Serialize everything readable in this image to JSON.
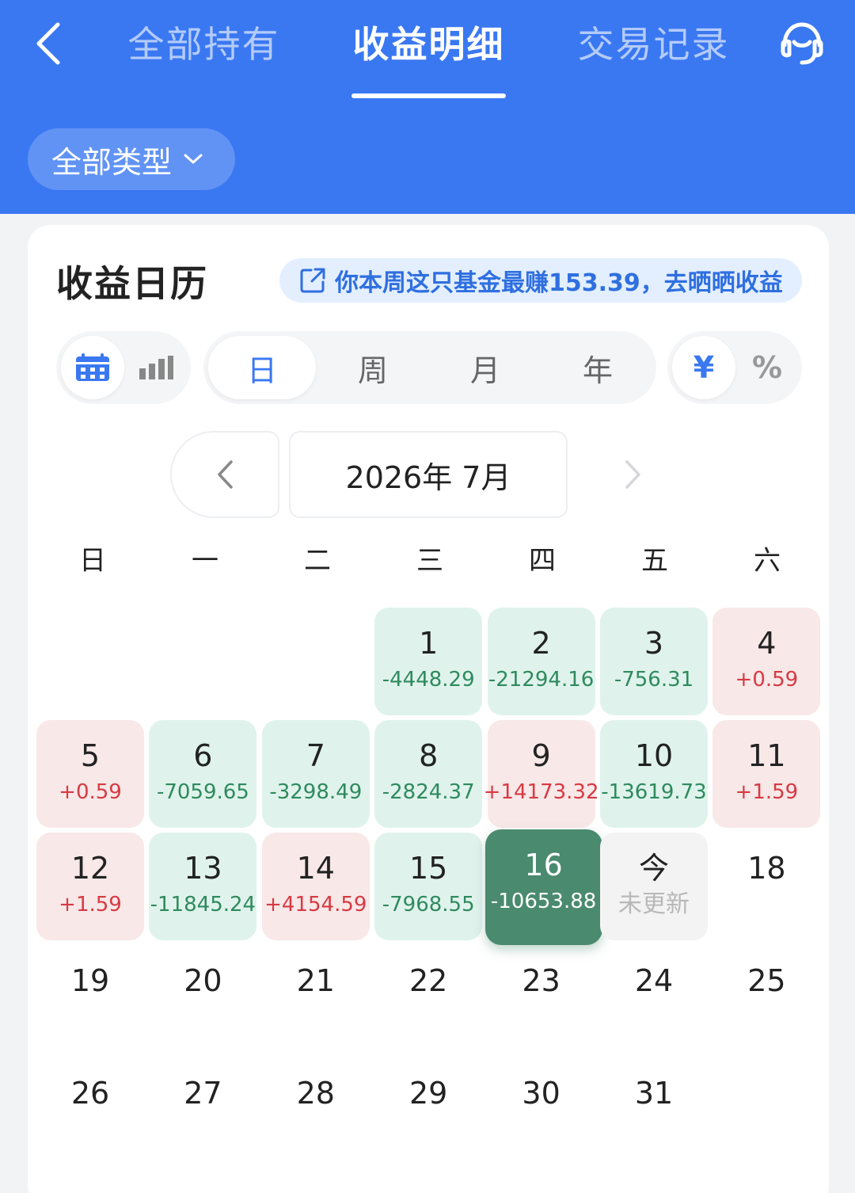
{
  "header": {
    "tabs": [
      {
        "label": "全部持有"
      },
      {
        "label": "收益明细"
      },
      {
        "label": "交易记录"
      }
    ],
    "type_filter": "全部类型"
  },
  "card": {
    "title": "收益日历",
    "promo": "你本周这只基金最赚153.39，去晒晒收益",
    "period_tabs": [
      "日",
      "周",
      "月",
      "年"
    ],
    "unit_tabs": [
      "¥",
      "%"
    ],
    "month_label": "2026年 7月",
    "weekdays": [
      "日",
      "一",
      "二",
      "三",
      "四",
      "五",
      "六"
    ]
  },
  "calendar": {
    "days": [
      {
        "d": "1",
        "v": "-4448.29",
        "t": "loss"
      },
      {
        "d": "2",
        "v": "-21294.16",
        "t": "loss"
      },
      {
        "d": "3",
        "v": "-756.31",
        "t": "loss"
      },
      {
        "d": "4",
        "v": "+0.59",
        "t": "gain"
      },
      {
        "d": "5",
        "v": "+0.59",
        "t": "gain"
      },
      {
        "d": "6",
        "v": "-7059.65",
        "t": "loss"
      },
      {
        "d": "7",
        "v": "-3298.49",
        "t": "loss"
      },
      {
        "d": "8",
        "v": "-2824.37",
        "t": "loss"
      },
      {
        "d": "9",
        "v": "+14173.32",
        "t": "gain"
      },
      {
        "d": "10",
        "v": "-13619.73",
        "t": "loss"
      },
      {
        "d": "11",
        "v": "+1.59",
        "t": "gain"
      },
      {
        "d": "12",
        "v": "+1.59",
        "t": "gain"
      },
      {
        "d": "13",
        "v": "-11845.24",
        "t": "loss"
      },
      {
        "d": "14",
        "v": "+4154.59",
        "t": "gain"
      },
      {
        "d": "15",
        "v": "-7968.55",
        "t": "loss"
      },
      {
        "d": "16",
        "v": "-10653.88",
        "t": "selected"
      },
      {
        "d": "今",
        "v": "未更新",
        "t": "pending"
      },
      {
        "d": "18",
        "v": "",
        "t": "plain"
      },
      {
        "d": "19",
        "v": "",
        "t": "plain"
      },
      {
        "d": "20",
        "v": "",
        "t": "plain"
      },
      {
        "d": "21",
        "v": "",
        "t": "plain"
      },
      {
        "d": "22",
        "v": "",
        "t": "plain"
      },
      {
        "d": "23",
        "v": "",
        "t": "plain"
      },
      {
        "d": "24",
        "v": "",
        "t": "plain"
      },
      {
        "d": "25",
        "v": "",
        "t": "plain"
      },
      {
        "d": "26",
        "v": "",
        "t": "plain"
      },
      {
        "d": "27",
        "v": "",
        "t": "plain"
      },
      {
        "d": "28",
        "v": "",
        "t": "plain"
      },
      {
        "d": "29",
        "v": "",
        "t": "plain"
      },
      {
        "d": "30",
        "v": "",
        "t": "plain"
      },
      {
        "d": "31",
        "v": "",
        "t": "plain"
      }
    ]
  },
  "colors": {
    "header_blue": "#3a78f2",
    "loss_green": "#2f8a5e",
    "gain_red": "#d73a43",
    "selected_green": "#4a8a6f"
  }
}
